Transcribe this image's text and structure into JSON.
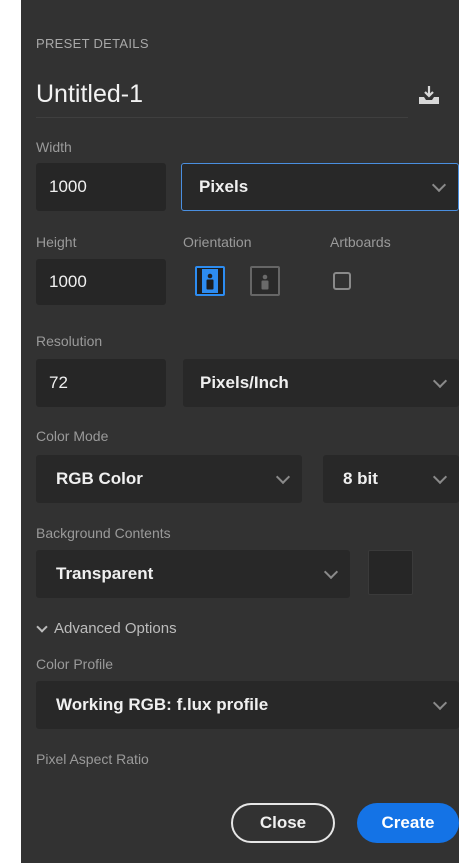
{
  "preset": {
    "section_title": "PRESET DETAILS",
    "doc_name": "Untitled-1"
  },
  "width": {
    "label": "Width",
    "value": "1000",
    "unit": "Pixels"
  },
  "height": {
    "label": "Height",
    "value": "1000"
  },
  "orientation": {
    "label": "Orientation",
    "selected": "portrait"
  },
  "artboards": {
    "label": "Artboards",
    "checked": false
  },
  "resolution": {
    "label": "Resolution",
    "value": "72",
    "unit": "Pixels/Inch"
  },
  "color_mode": {
    "label": "Color Mode",
    "mode": "RGB Color",
    "depth": "8 bit"
  },
  "background": {
    "label": "Background Contents",
    "value": "Transparent"
  },
  "advanced": {
    "title": "Advanced Options",
    "color_profile_label": "Color Profile",
    "color_profile_value": "Working RGB: f.lux profile",
    "pixel_aspect_label": "Pixel Aspect Ratio"
  },
  "buttons": {
    "close": "Close",
    "create": "Create"
  },
  "colors": {
    "panel_bg": "#323232",
    "accent": "#1473e6",
    "focus_border": "#4a8fe0"
  },
  "icons": {
    "save_preset": "save-preset-icon",
    "dropdown": "chevron-down-icon",
    "portrait": "portrait-orientation-icon",
    "landscape": "landscape-orientation-icon"
  }
}
